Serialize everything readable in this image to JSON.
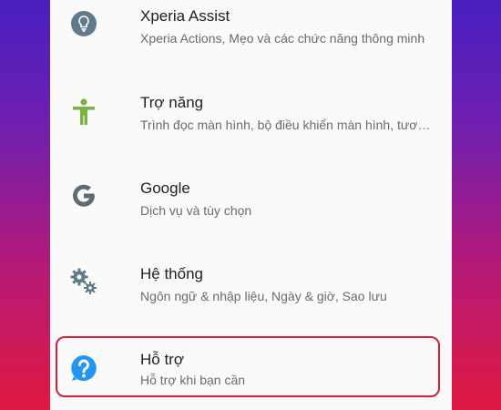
{
  "settings": {
    "items": [
      {
        "icon": "lightbulb-icon",
        "title": "Xperia Assist",
        "subtitle": "Xperia Actions, Mẹo và các chức năng thông minh"
      },
      {
        "icon": "accessibility-icon",
        "title": "Trợ năng",
        "subtitle": "Trình đọc màn hình, bộ điều khiển màn hình, tương tác"
      },
      {
        "icon": "google-icon",
        "title": "Google",
        "subtitle": "Dịch vụ và tùy chọn"
      },
      {
        "icon": "gears-icon",
        "title": "Hệ thống",
        "subtitle": "Ngôn ngữ & nhập liệu, Ngày & giờ, Sao lưu"
      },
      {
        "icon": "help-icon",
        "title": "Hỗ trợ",
        "subtitle": "Hỗ trợ khi bạn cần"
      }
    ]
  },
  "colors": {
    "highlight_border": "#d6203a",
    "accessibility_icon": "#7cb342",
    "help_icon": "#2196f3",
    "icon_gray": "#5f7a8a"
  }
}
